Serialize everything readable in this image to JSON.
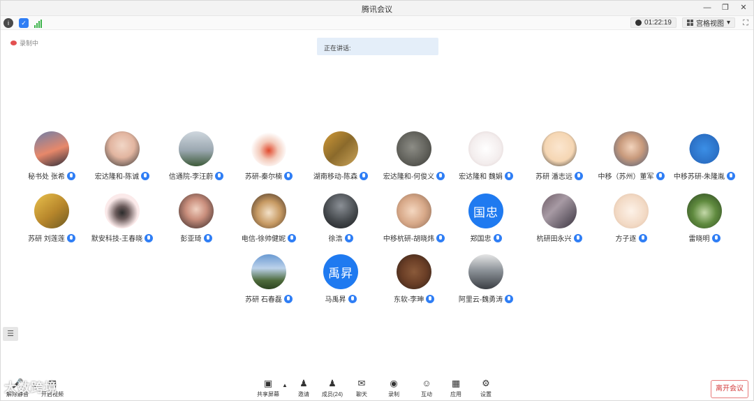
{
  "window": {
    "title": "腾讯会议"
  },
  "statusbar": {
    "timer": "01:22:19",
    "view_label": "宫格视图"
  },
  "recording": {
    "label": "录制中"
  },
  "speaking": {
    "label": "正在讲话:"
  },
  "participants": [
    {
      "name": "秘书处 张希",
      "avatar": "photo-sunset",
      "bg": "linear-gradient(160deg,#6f7fa8 0%,#e7886a 55%,#2d2d3a 100%)"
    },
    {
      "name": "宏达隆和-陈诚",
      "avatar": "photo-face",
      "bg": "radial-gradient(circle at 50% 40%,#f1d6c6 0%,#e2b5a0 45%,#333 100%)"
    },
    {
      "name": "信通院-李汪蔚",
      "avatar": "photo-lake",
      "bg": "linear-gradient(180deg,#cfd7de 0%,#9aa7b0 55%,#3e5b3a 100%)"
    },
    {
      "name": "苏研-秦尔楠",
      "avatar": "logo-bird",
      "bg": "radial-gradient(circle at 50% 55%,#e24a2e 0%,#f3c9b9 35%,#ffffff 70%)"
    },
    {
      "name": "湖南移动-陈森",
      "avatar": "photo-leaves",
      "bg": "linear-gradient(135deg,#d19a38 0%,#8b6a2b 50%,#caa45a 100%)"
    },
    {
      "name": "宏达隆和-何俊义",
      "avatar": "photo-rock",
      "bg": "radial-gradient(circle at 45% 45%,#8d8d86 0%,#5d5d57 60%,#3a3a36 100%)"
    },
    {
      "name": "宏达隆和 魏娟",
      "avatar": "drawing-girl",
      "bg": "radial-gradient(circle at 50% 50%,#ffffff 0%,#f3eded 60%,#d9c9c9 100%)"
    },
    {
      "name": "苏研 潘志远",
      "avatar": "cartoon-man",
      "bg": "radial-gradient(circle at 50% 45%,#fbe6cf 0%,#f5d6b3 55%,#2b2b2b 100%)"
    },
    {
      "name": "中移（苏州）董军",
      "avatar": "photo-child",
      "bg": "radial-gradient(circle at 50% 45%,#f2d3bc 0%,#c89a7c 45%,#4a5d7a 100%)"
    },
    {
      "name": "中移苏研-朱隆胤",
      "avatar": "cartoon-dog",
      "bg": "radial-gradient(circle at 50% 50%,#3b8fe6 0%,#2b6fc4 60%,#ffffff 61%)"
    },
    {
      "name": "苏研 刘莲莲",
      "avatar": "photo-ginkgo",
      "bg": "linear-gradient(140deg,#e9c14d 0%,#b7862b 55%,#6d5a22 100%)"
    },
    {
      "name": "默安科技-王春晓",
      "avatar": "cartoon-girl",
      "bg": "radial-gradient(circle at 50% 55%,#2b2b2b 0%,#6b5b5b 25%,#fbeaea 60%)"
    },
    {
      "name": "彭亚琦",
      "avatar": "photo-woman",
      "bg": "radial-gradient(circle at 50% 45%,#f0d0c0 0%,#c98e7c 40%,#2e2424 100%)"
    },
    {
      "name": "电信-徐帅健妮",
      "avatar": "photo-dog",
      "bg": "radial-gradient(circle at 50% 55%,#f3e1c8 0%,#c79a63 45%,#3a2a20 100%)"
    },
    {
      "name": "徐浩",
      "avatar": "photo-dark",
      "bg": "radial-gradient(circle at 50% 35%,#8b9096 0%,#45494d 55%,#1c1e20 100%)"
    },
    {
      "name": "中移杭研-胡晓炜",
      "avatar": "photo-baby",
      "bg": "radial-gradient(circle at 45% 50%,#f4d7c0 0%,#d7a888 50%,#8b6a55 100%)"
    },
    {
      "name": "郑国忠",
      "avatar": "initials",
      "initials": "国忠",
      "bg": "#1f7af0"
    },
    {
      "name": "杭研田永兴",
      "avatar": "photo-piano",
      "bg": "linear-gradient(135deg,#6d5b66 0%,#a79aa4 40%,#3a3440 100%)"
    },
    {
      "name": "方子逐",
      "avatar": "drawing-girl2",
      "bg": "radial-gradient(circle at 50% 50%,#fdf2e8 0%,#f2d9c4 60%,#d9b9a0 100%)"
    },
    {
      "name": "雷晓明",
      "avatar": "photo-forest",
      "bg": "radial-gradient(circle at 50% 55%,#c4d9a9 0%,#5f8a3e 45%,#2b4421 100%)"
    },
    {
      "name": "苏研 石春磊",
      "avatar": "photo-mountain",
      "bg": "linear-gradient(180deg,#6a9ad2 0%,#bcd2ea 40%,#4d6a3b 75%,#2d4420 100%)"
    },
    {
      "name": "马禹昇",
      "avatar": "initials",
      "initials": "禹昇",
      "bg": "#1f7af0"
    },
    {
      "name": "东软-李珅",
      "avatar": "photo-bear",
      "bg": "radial-gradient(circle at 50% 50%,#8a5a3a 0%,#6a3e26 50%,#2e2018 100%)"
    },
    {
      "name": "阿里云-魏勇涛",
      "avatar": "photo-road",
      "bg": "linear-gradient(180deg,#e6e6e6 0%,#8e949a 45%,#3b3f44 100%)"
    }
  ],
  "toolbar": {
    "mute": "解除静音",
    "video": "开启视频",
    "share": "共享屏幕",
    "invite": "邀请",
    "members": "成员(24)",
    "chat": "聊天",
    "record": "录制",
    "interact": "互动",
    "apps": "应用",
    "settings": "设置",
    "leave": "离开会议"
  },
  "watermark": "大数跨境"
}
